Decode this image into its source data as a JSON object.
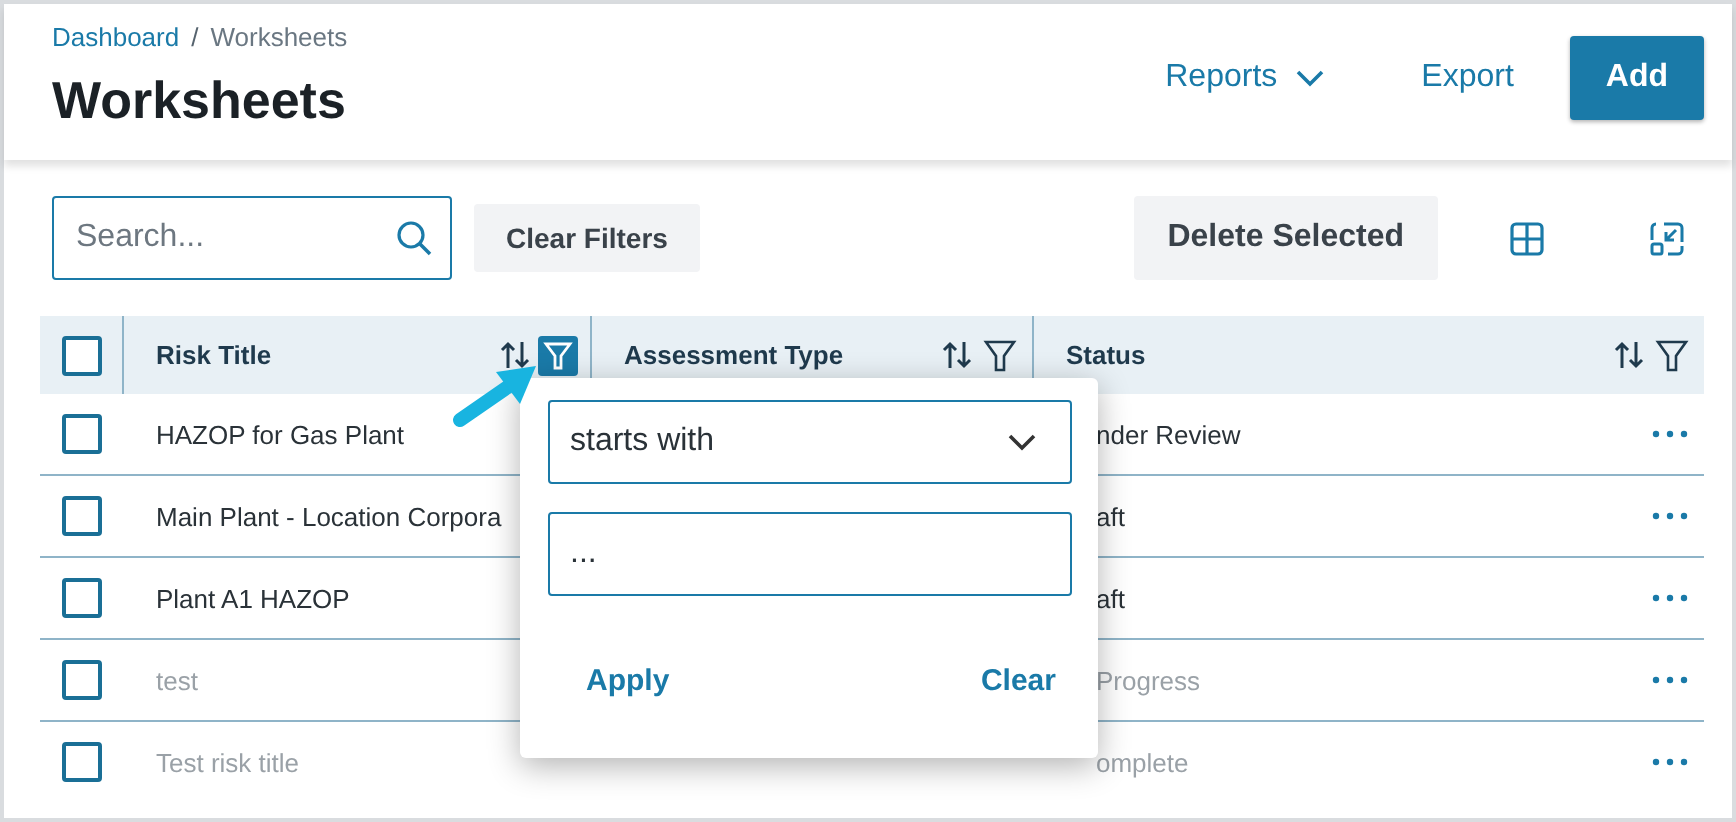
{
  "breadcrumb": [
    {
      "label": "Dashboard",
      "link": true
    },
    {
      "label": "Worksheets",
      "link": false
    }
  ],
  "breadcrumb_separator": "/",
  "title": "Worksheets",
  "header_actions": [
    {
      "kind": "menu",
      "label": "Reports"
    },
    {
      "kind": "link",
      "label": "Export"
    },
    {
      "kind": "primary",
      "label": "Add"
    }
  ],
  "search": {
    "placeholder": "Search..."
  },
  "toolbar": {
    "clear_filters": "Clear Filters",
    "delete_selected": "Delete Selected"
  },
  "table": {
    "columns": [
      {
        "label": "Risk Title",
        "filter_active": true
      },
      {
        "label": "Assessment Type",
        "filter_active": false
      },
      {
        "label": "Status",
        "filter_active": false
      }
    ],
    "header_checked": false,
    "rows": [
      {
        "checked": false,
        "blurred": false,
        "risk_title": "HAZOP for Gas Plant",
        "status": "nder Review"
      },
      {
        "checked": false,
        "blurred": false,
        "risk_title": "Main Plant - Location Corpora",
        "status": "aft"
      },
      {
        "checked": false,
        "blurred": false,
        "risk_title": "Plant A1 HAZOP",
        "status": "aft"
      },
      {
        "checked": false,
        "blurred": true,
        "risk_title": "test",
        "status": "Progress"
      },
      {
        "checked": false,
        "blurred": true,
        "risk_title": "Test risk title",
        "status": "omplete"
      }
    ]
  },
  "filter_popup": {
    "operator": "starts with",
    "placeholder": "...",
    "buttons": [
      "Apply",
      "Clear"
    ]
  }
}
